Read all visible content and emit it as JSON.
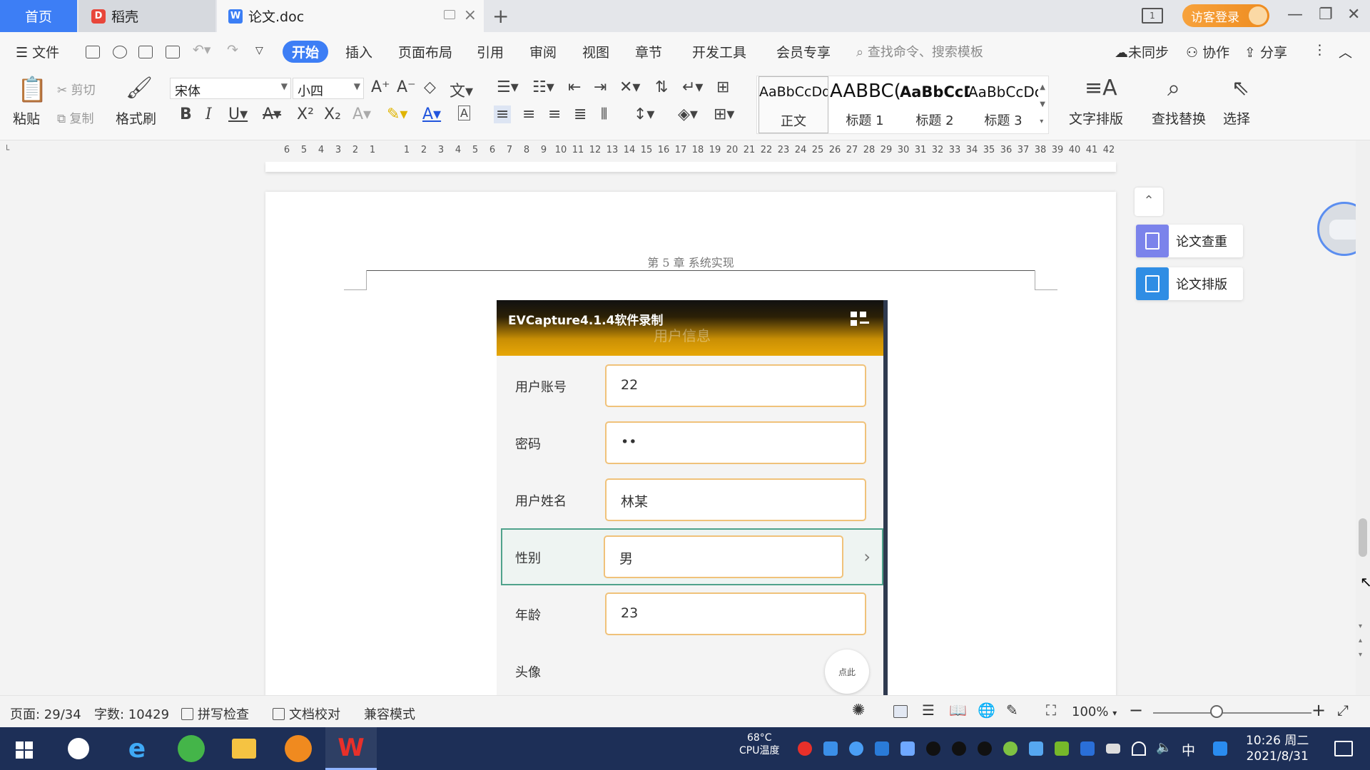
{
  "tabs": {
    "home": "首页",
    "daoke": "稻壳",
    "document": "论文.doc"
  },
  "titlebar": {
    "visitor_login": "访客登录",
    "layout_icon_text": "1"
  },
  "menu": {
    "file": "文件",
    "start": "开始",
    "insert": "插入",
    "page_layout": "页面布局",
    "references": "引用",
    "review": "审阅",
    "view": "视图",
    "chapter": "章节",
    "developer": "开发工具",
    "member": "会员专享",
    "search_placeholder": "查找命令、搜索模板",
    "not_synced": "未同步",
    "collaborate": "协作",
    "share": "分享"
  },
  "ribbon": {
    "paste": "粘贴",
    "cut": "剪切",
    "copy": "复制",
    "format_painter": "格式刷",
    "font_name": "宋体",
    "font_size": "小四",
    "text_layout": "文字排版",
    "find_replace": "查找替换",
    "select": "选择",
    "styles": [
      {
        "sample": "AaBbCcDd",
        "name": "正文"
      },
      {
        "sample": "AABBC(",
        "name": "标题 1"
      },
      {
        "sample": "AaBbCcD",
        "name": "标题 2"
      },
      {
        "sample": "AaBbCcDc",
        "name": "标题 3"
      }
    ]
  },
  "ruler": {
    "ticks": [
      "6",
      "5",
      "4",
      "3",
      "2",
      "1",
      "",
      "1",
      "2",
      "3",
      "4",
      "5",
      "6",
      "7",
      "8",
      "9",
      "10",
      "11",
      "12",
      "13",
      "14",
      "15",
      "16",
      "17",
      "18",
      "19",
      "20",
      "21",
      "22",
      "23",
      "24",
      "25",
      "26",
      "27",
      "28",
      "29",
      "30",
      "31",
      "32",
      "33",
      "34",
      "35",
      "36",
      "37",
      "38",
      "39",
      "40",
      "41",
      "42"
    ]
  },
  "document": {
    "chapter_header": "第 5 章  系统实现",
    "phone": {
      "title": "EVCapture4.1.4软件录制",
      "sub_title": "用户信息",
      "fields": [
        {
          "label": "用户账号",
          "value": "22"
        },
        {
          "label": "密码",
          "value": "••"
        },
        {
          "label": "用户姓名",
          "value": "林某"
        },
        {
          "label": "性别",
          "value": "男"
        },
        {
          "label": "年龄",
          "value": "23"
        },
        {
          "label": "头像",
          "value": "点此"
        }
      ]
    }
  },
  "side_panel": {
    "check": "论文查重",
    "format": "论文排版",
    "check_color": "#7b83eb",
    "format_color": "#2f8de4"
  },
  "statusbar": {
    "page": "页面: 29/34",
    "word_count": "字数: 10429",
    "spell_check": "拼写检查",
    "doc_proof": "文档校对",
    "compat_mode": "兼容模式",
    "zoom": "100%",
    "zoom_level": 0.4
  },
  "taskbar": {
    "cpu_temp": "68°C",
    "cpu_label": "CPU温度",
    "ime": "中",
    "time": "10:26 周二",
    "date": "2021/8/31"
  }
}
